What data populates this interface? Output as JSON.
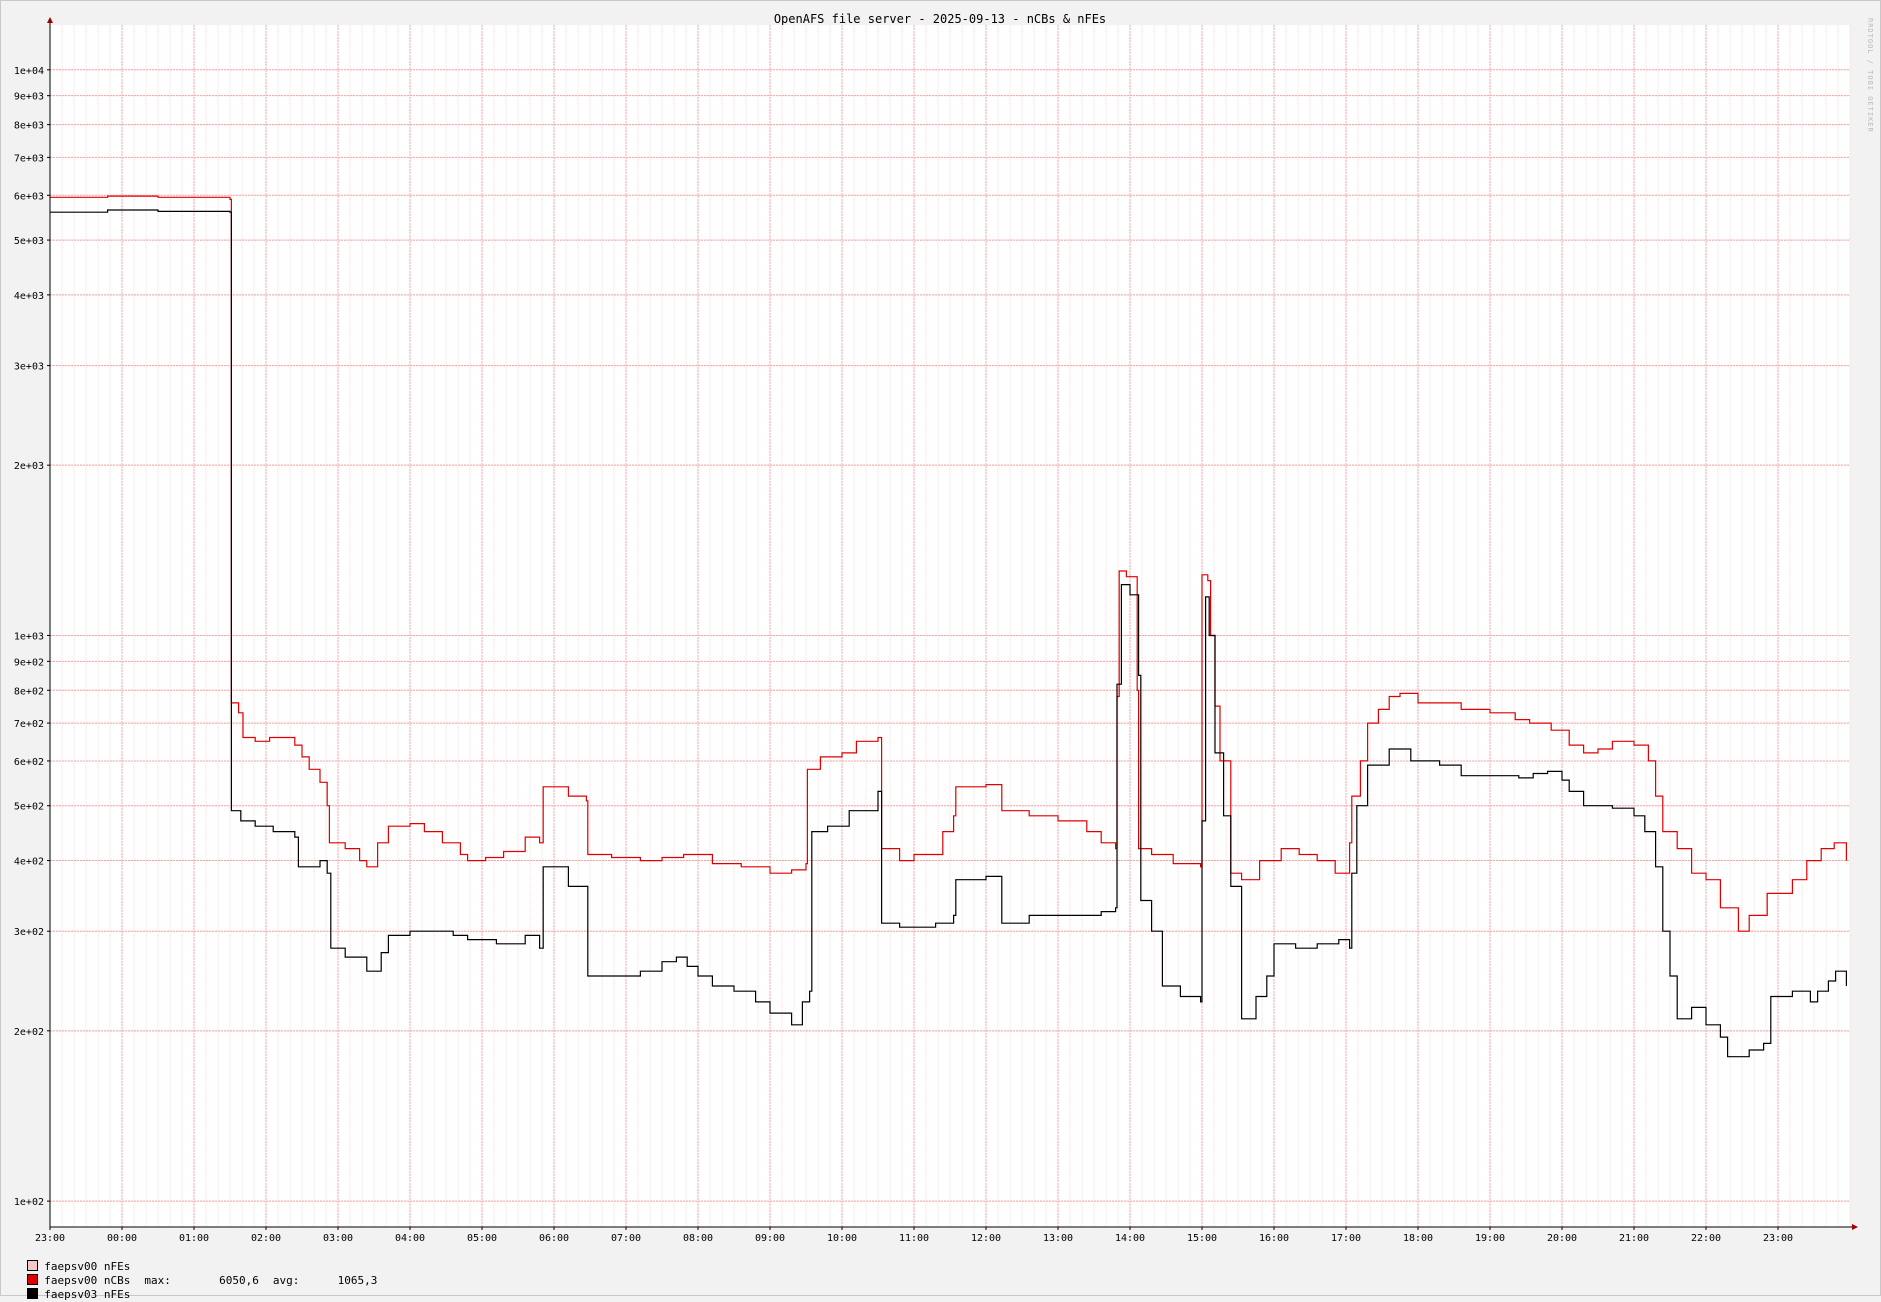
{
  "chart_data": {
    "type": "line",
    "title": "OpenAFS file server - 2025-09-13 - nCBs & nFEs",
    "watermark": "RRDTOOL / TOBI OETIKER",
    "yscale": "log",
    "ylim": [
      90,
      12000
    ],
    "y_ticks": [
      {
        "value": 100,
        "label": "1e+02"
      },
      {
        "value": 200,
        "label": "2e+02"
      },
      {
        "value": 300,
        "label": "3e+02"
      },
      {
        "value": 400,
        "label": "4e+02"
      },
      {
        "value": 500,
        "label": "5e+02"
      },
      {
        "value": 600,
        "label": "6e+02"
      },
      {
        "value": 700,
        "label": "7e+02"
      },
      {
        "value": 800,
        "label": "8e+02"
      },
      {
        "value": 900,
        "label": "9e+02"
      },
      {
        "value": 1000,
        "label": "1e+03"
      },
      {
        "value": 2000,
        "label": "2e+03"
      },
      {
        "value": 3000,
        "label": "3e+03"
      },
      {
        "value": 4000,
        "label": "4e+03"
      },
      {
        "value": 5000,
        "label": "5e+03"
      },
      {
        "value": 6000,
        "label": "6e+03"
      },
      {
        "value": 7000,
        "label": "7e+03"
      },
      {
        "value": 8000,
        "label": "8e+03"
      },
      {
        "value": 9000,
        "label": "9e+03"
      },
      {
        "value": 10000,
        "label": "1e+04"
      }
    ],
    "xlim": [
      23.0,
      48.0
    ],
    "x_ticks": [
      {
        "value": 23,
        "label": "23:00"
      },
      {
        "value": 24,
        "label": "00:00"
      },
      {
        "value": 25,
        "label": "01:00"
      },
      {
        "value": 26,
        "label": "02:00"
      },
      {
        "value": 27,
        "label": "03:00"
      },
      {
        "value": 28,
        "label": "04:00"
      },
      {
        "value": 29,
        "label": "05:00"
      },
      {
        "value": 30,
        "label": "06:00"
      },
      {
        "value": 31,
        "label": "07:00"
      },
      {
        "value": 32,
        "label": "08:00"
      },
      {
        "value": 33,
        "label": "09:00"
      },
      {
        "value": 34,
        "label": "10:00"
      },
      {
        "value": 35,
        "label": "11:00"
      },
      {
        "value": 36,
        "label": "12:00"
      },
      {
        "value": 37,
        "label": "13:00"
      },
      {
        "value": 38,
        "label": "14:00"
      },
      {
        "value": 39,
        "label": "15:00"
      },
      {
        "value": 40,
        "label": "16:00"
      },
      {
        "value": 41,
        "label": "17:00"
      },
      {
        "value": 42,
        "label": "18:00"
      },
      {
        "value": 43,
        "label": "19:00"
      },
      {
        "value": 44,
        "label": "20:00"
      },
      {
        "value": 45,
        "label": "21:00"
      },
      {
        "value": 46,
        "label": "22:00"
      },
      {
        "value": 47,
        "label": "23:00"
      }
    ],
    "series": [
      {
        "name": "faepsv00 nFEs",
        "color": "#f2c8c8",
        "points": []
      },
      {
        "name": "faepsv00 nCBs",
        "color": "#e00000",
        "max_label": "max:",
        "max_value": "6050,6",
        "avg_label": "avg:",
        "avg_value": "1065,3",
        "points": [
          [
            23.0,
            5950
          ],
          [
            23.8,
            5980
          ],
          [
            24.5,
            5950
          ],
          [
            25.5,
            5900
          ],
          [
            25.52,
            760
          ],
          [
            25.62,
            730
          ],
          [
            25.68,
            660
          ],
          [
            25.85,
            650
          ],
          [
            26.05,
            660
          ],
          [
            26.4,
            640
          ],
          [
            26.5,
            610
          ],
          [
            26.6,
            580
          ],
          [
            26.75,
            550
          ],
          [
            26.85,
            500
          ],
          [
            26.88,
            430
          ],
          [
            27.1,
            420
          ],
          [
            27.3,
            400
          ],
          [
            27.4,
            390
          ],
          [
            27.55,
            430
          ],
          [
            27.7,
            460
          ],
          [
            28.0,
            465
          ],
          [
            28.2,
            450
          ],
          [
            28.45,
            430
          ],
          [
            28.7,
            410
          ],
          [
            28.8,
            400
          ],
          [
            29.05,
            405
          ],
          [
            29.3,
            415
          ],
          [
            29.6,
            440
          ],
          [
            29.8,
            430
          ],
          [
            29.85,
            540
          ],
          [
            30.2,
            520
          ],
          [
            30.45,
            510
          ],
          [
            30.47,
            410
          ],
          [
            30.8,
            405
          ],
          [
            31.2,
            400
          ],
          [
            31.5,
            405
          ],
          [
            31.8,
            410
          ],
          [
            32.2,
            395
          ],
          [
            32.6,
            390
          ],
          [
            33.0,
            380
          ],
          [
            33.3,
            385
          ],
          [
            33.5,
            395
          ],
          [
            33.52,
            580
          ],
          [
            33.7,
            610
          ],
          [
            34.0,
            620
          ],
          [
            34.2,
            650
          ],
          [
            34.5,
            660
          ],
          [
            34.55,
            420
          ],
          [
            34.8,
            400
          ],
          [
            35.0,
            410
          ],
          [
            35.4,
            450
          ],
          [
            35.55,
            480
          ],
          [
            35.58,
            540
          ],
          [
            36.0,
            545
          ],
          [
            36.2,
            545
          ],
          [
            36.22,
            490
          ],
          [
            36.6,
            480
          ],
          [
            37.0,
            470
          ],
          [
            37.4,
            450
          ],
          [
            37.6,
            430
          ],
          [
            37.8,
            420
          ],
          [
            37.82,
            780
          ],
          [
            37.85,
            1300
          ],
          [
            37.95,
            1270
          ],
          [
            38.1,
            800
          ],
          [
            38.12,
            420
          ],
          [
            38.3,
            410
          ],
          [
            38.6,
            395
          ],
          [
            38.98,
            390
          ],
          [
            39.0,
            1280
          ],
          [
            39.08,
            1250
          ],
          [
            39.12,
            1000
          ],
          [
            39.18,
            750
          ],
          [
            39.25,
            600
          ],
          [
            39.4,
            380
          ],
          [
            39.55,
            370
          ],
          [
            39.8,
            400
          ],
          [
            40.1,
            420
          ],
          [
            40.35,
            410
          ],
          [
            40.6,
            400
          ],
          [
            40.85,
            380
          ],
          [
            41.05,
            430
          ],
          [
            41.08,
            520
          ],
          [
            41.2,
            600
          ],
          [
            41.3,
            700
          ],
          [
            41.45,
            740
          ],
          [
            41.6,
            780
          ],
          [
            41.75,
            790
          ],
          [
            42.0,
            760
          ],
          [
            42.3,
            760
          ],
          [
            42.6,
            740
          ],
          [
            43.0,
            730
          ],
          [
            43.35,
            710
          ],
          [
            43.55,
            700
          ],
          [
            43.85,
            680
          ],
          [
            44.1,
            640
          ],
          [
            44.3,
            620
          ],
          [
            44.5,
            630
          ],
          [
            44.7,
            650
          ],
          [
            45.0,
            640
          ],
          [
            45.2,
            600
          ],
          [
            45.3,
            520
          ],
          [
            45.4,
            450
          ],
          [
            45.6,
            420
          ],
          [
            45.8,
            380
          ],
          [
            46.0,
            370
          ],
          [
            46.2,
            330
          ],
          [
            46.45,
            300
          ],
          [
            46.6,
            320
          ],
          [
            46.85,
            350
          ],
          [
            47.2,
            370
          ],
          [
            47.4,
            400
          ],
          [
            47.6,
            420
          ],
          [
            47.78,
            430
          ],
          [
            47.95,
            400
          ]
        ]
      },
      {
        "name": "faepsv03 nFEs",
        "color": "#000000",
        "points": [
          [
            23.0,
            5600
          ],
          [
            23.8,
            5650
          ],
          [
            24.5,
            5620
          ],
          [
            25.5,
            5600
          ],
          [
            25.52,
            490
          ],
          [
            25.65,
            470
          ],
          [
            25.85,
            460
          ],
          [
            26.1,
            450
          ],
          [
            26.4,
            440
          ],
          [
            26.45,
            390
          ],
          [
            26.75,
            400
          ],
          [
            26.85,
            380
          ],
          [
            26.9,
            280
          ],
          [
            27.1,
            270
          ],
          [
            27.4,
            255
          ],
          [
            27.6,
            275
          ],
          [
            27.7,
            295
          ],
          [
            28.0,
            300
          ],
          [
            28.3,
            300
          ],
          [
            28.6,
            295
          ],
          [
            28.8,
            290
          ],
          [
            29.2,
            285
          ],
          [
            29.6,
            295
          ],
          [
            29.8,
            280
          ],
          [
            29.85,
            390
          ],
          [
            30.2,
            360
          ],
          [
            30.45,
            360
          ],
          [
            30.47,
            250
          ],
          [
            30.8,
            250
          ],
          [
            31.2,
            255
          ],
          [
            31.5,
            265
          ],
          [
            31.7,
            270
          ],
          [
            31.85,
            260
          ],
          [
            32.0,
            250
          ],
          [
            32.2,
            240
          ],
          [
            32.5,
            235
          ],
          [
            32.8,
            225
          ],
          [
            33.0,
            215
          ],
          [
            33.3,
            205
          ],
          [
            33.45,
            225
          ],
          [
            33.55,
            235
          ],
          [
            33.58,
            450
          ],
          [
            33.8,
            460
          ],
          [
            34.1,
            490
          ],
          [
            34.5,
            530
          ],
          [
            34.55,
            310
          ],
          [
            34.8,
            305
          ],
          [
            35.0,
            305
          ],
          [
            35.3,
            310
          ],
          [
            35.55,
            320
          ],
          [
            35.58,
            370
          ],
          [
            36.0,
            375
          ],
          [
            36.2,
            375
          ],
          [
            36.22,
            310
          ],
          [
            36.6,
            320
          ],
          [
            37.0,
            320
          ],
          [
            37.4,
            320
          ],
          [
            37.6,
            325
          ],
          [
            37.8,
            330
          ],
          [
            37.82,
            820
          ],
          [
            37.88,
            1230
          ],
          [
            38.0,
            1180
          ],
          [
            38.12,
            850
          ],
          [
            38.15,
            340
          ],
          [
            38.3,
            300
          ],
          [
            38.45,
            240
          ],
          [
            38.7,
            230
          ],
          [
            38.98,
            225
          ],
          [
            39.0,
            470
          ],
          [
            39.05,
            1170
          ],
          [
            39.1,
            1000
          ],
          [
            39.18,
            620
          ],
          [
            39.3,
            480
          ],
          [
            39.4,
            360
          ],
          [
            39.55,
            210
          ],
          [
            39.75,
            230
          ],
          [
            39.9,
            250
          ],
          [
            40.0,
            285
          ],
          [
            40.3,
            280
          ],
          [
            40.6,
            285
          ],
          [
            40.9,
            290
          ],
          [
            41.05,
            280
          ],
          [
            41.08,
            380
          ],
          [
            41.15,
            500
          ],
          [
            41.3,
            590
          ],
          [
            41.6,
            630
          ],
          [
            41.9,
            600
          ],
          [
            42.3,
            590
          ],
          [
            42.6,
            565
          ],
          [
            43.0,
            565
          ],
          [
            43.4,
            560
          ],
          [
            43.6,
            570
          ],
          [
            43.8,
            575
          ],
          [
            44.0,
            555
          ],
          [
            44.1,
            530
          ],
          [
            44.3,
            500
          ],
          [
            44.7,
            495
          ],
          [
            45.0,
            480
          ],
          [
            45.15,
            450
          ],
          [
            45.3,
            390
          ],
          [
            45.4,
            300
          ],
          [
            45.5,
            250
          ],
          [
            45.6,
            210
          ],
          [
            45.8,
            220
          ],
          [
            46.0,
            205
          ],
          [
            46.2,
            195
          ],
          [
            46.3,
            180
          ],
          [
            46.6,
            185
          ],
          [
            46.8,
            190
          ],
          [
            46.9,
            230
          ],
          [
            47.2,
            235
          ],
          [
            47.45,
            225
          ],
          [
            47.55,
            235
          ],
          [
            47.7,
            245
          ],
          [
            47.8,
            255
          ],
          [
            47.95,
            240
          ]
        ]
      }
    ]
  }
}
